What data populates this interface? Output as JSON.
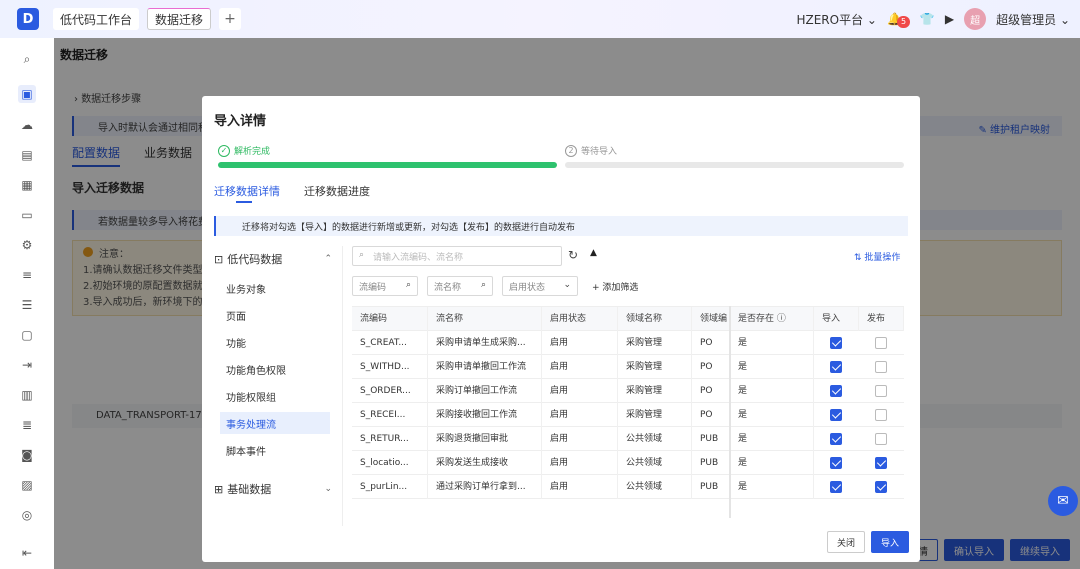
{
  "topbar": {
    "logo": "D",
    "tabs": [
      {
        "label": "低代码工作台"
      },
      {
        "label": "数据迁移"
      }
    ],
    "add_tab": "+",
    "platform": "HZERO平台",
    "notification_count": "5",
    "avatar_text": "超",
    "user": "超级管理员"
  },
  "page": {
    "title": "数据迁移",
    "steps_label": "数据迁移步骤",
    "info": "导入时默认会通过相同租户",
    "maintain": "维护租户映射",
    "tabs": [
      "配置数据",
      "业务数据"
    ],
    "subtitle": "导入迁移数据",
    "info2": "若数据量较多导入将花费较",
    "warning_title": "注意：",
    "warning_lines": [
      "1.请确认数据迁移文件类型",
      "2.初始环境的原配置数据就",
      "3.导入成功后，新环境下的"
    ],
    "row_text": "DATA_TRANSPORT-1739",
    "bottom_buttons": [
      "情",
      "确认导入",
      "继续导入"
    ]
  },
  "modal": {
    "title": "导入详情",
    "step1_label": "解析完成",
    "step2_num": "2",
    "step2_label": "等待导入",
    "tabs": [
      "迁移数据详情",
      "迁移数据进度"
    ],
    "info": "迁移将对勾选【导入】的数据进行新增或更新，对勾选【发布】的数据进行自动发布",
    "tree": {
      "group1": "低代码数据",
      "items": [
        "业务对象",
        "页面",
        "功能",
        "功能角色权限",
        "功能权限组",
        "事务处理流",
        "脚本事件"
      ],
      "group2": "基础数据"
    },
    "search_placeholder": "请输入流编码、流名称",
    "batch": "批量操作",
    "filters": [
      "流编码",
      "流名称",
      "启用状态"
    ],
    "add_filter": "添加筛选",
    "columns": [
      "流编码",
      "流名称",
      "启用状态",
      "领域名称",
      "领域编",
      "是否存在",
      "导入",
      "发布"
    ],
    "rows": [
      {
        "code": "S_CREAT...",
        "name": "采购申请单生成采购...",
        "status": "启用",
        "domain": "采购管理",
        "dcode": "PO",
        "exists": "是",
        "import": true,
        "publish": false
      },
      {
        "code": "S_WITHD...",
        "name": "采购申请单撤回工作流",
        "status": "启用",
        "domain": "采购管理",
        "dcode": "PO",
        "exists": "是",
        "import": true,
        "publish": false
      },
      {
        "code": "S_ORDER...",
        "name": "采购订单撤回工作流",
        "status": "启用",
        "domain": "采购管理",
        "dcode": "PO",
        "exists": "是",
        "import": true,
        "publish": false
      },
      {
        "code": "S_RECEI...",
        "name": "采购接收撤回工作流",
        "status": "启用",
        "domain": "采购管理",
        "dcode": "PO",
        "exists": "是",
        "import": true,
        "publish": false
      },
      {
        "code": "S_RETUR...",
        "name": "采购退货撤回审批",
        "status": "启用",
        "domain": "公共领域",
        "dcode": "PUB",
        "exists": "是",
        "import": true,
        "publish": false
      },
      {
        "code": "S_locatio...",
        "name": "采购发送生成接收",
        "status": "启用",
        "domain": "公共领域",
        "dcode": "PUB",
        "exists": "是",
        "import": true,
        "publish": true
      },
      {
        "code": "S_purLin...",
        "name": "通过采购订单行拿到...",
        "status": "启用",
        "domain": "公共领域",
        "dcode": "PUB",
        "exists": "是",
        "import": true,
        "publish": true
      }
    ],
    "close": "关闭",
    "import": "导入"
  },
  "help_icon": "help-chat-icon"
}
